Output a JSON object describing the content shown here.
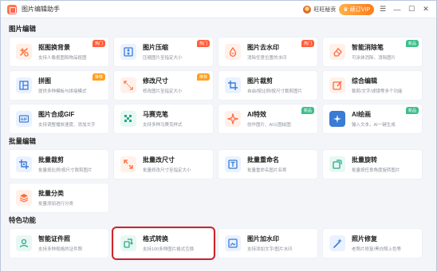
{
  "app": {
    "title": "图片编辑助手",
    "user_name": "旺旺秘贡",
    "vip_label": "续订VIP"
  },
  "colors": {
    "hot": "#ff5f3d",
    "recommend": "#ff9f1c",
    "new": "#3bbf8a",
    "highlight": "#d0232a"
  },
  "sections": [
    {
      "title": "图片编辑",
      "cards": [
        {
          "name": "抠图换背景",
          "desc": "支持人像抠图和物品抠图",
          "badge": "热门",
          "badge_type": "hot",
          "icon": "cutout-icon",
          "icon_color": "#ff7a45",
          "icon_bg": "#fff1ea"
        },
        {
          "name": "图片压缩",
          "desc": "压缩图片至指定大小",
          "badge": "热门",
          "badge_type": "hot",
          "icon": "compress-icon",
          "icon_color": "#3a7bd5",
          "icon_bg": "#eaf2ff"
        },
        {
          "name": "图片去水印",
          "desc": "消除任意位置的水印",
          "badge": "热门",
          "badge_type": "hot",
          "icon": "watermark-remove-icon",
          "icon_color": "#ff6a3d",
          "icon_bg": "#fff1ea"
        },
        {
          "name": "智能消除笔",
          "desc": "可涂抹消除，消除图片",
          "badge": "新品",
          "badge_type": "new",
          "icon": "eraser-icon",
          "icon_color": "#ff6a3d",
          "icon_bg": "#fff1ea"
        },
        {
          "name": "拼图",
          "desc": "提供多种模板与拼接模式",
          "badge": "推荐",
          "badge_type": "rec",
          "icon": "collage-icon",
          "icon_color": "#3a7bd5",
          "icon_bg": "#eaf2ff"
        },
        {
          "name": "修改尺寸",
          "desc": "修改图片至指定大小",
          "badge": "推荐",
          "badge_type": "rec",
          "icon": "resize-icon",
          "icon_color": "#ff6a3d",
          "icon_bg": "#fff1ea"
        },
        {
          "name": "图片裁剪",
          "desc": "自由/按比例/按尺寸裁剪图片",
          "badge": "",
          "badge_type": "",
          "icon": "crop-icon",
          "icon_color": "#3a7bd5",
          "icon_bg": "#eaf2ff"
        },
        {
          "name": "综合编辑",
          "desc": "裁剪/文字/滤镜等多个功能",
          "badge": "",
          "badge_type": "",
          "icon": "edit-icon",
          "icon_color": "#ff6a3d",
          "icon_bg": "#fff1ea"
        },
        {
          "name": "图片合成GIF",
          "desc": "支持调整播放速度、添加文字",
          "badge": "",
          "badge_type": "",
          "icon": "gif-icon",
          "icon_color": "#3a7bd5",
          "icon_bg": "#eaf2ff"
        },
        {
          "name": "马赛克笔",
          "desc": "支持多种马赛克样式",
          "badge": "",
          "badge_type": "",
          "icon": "mosaic-icon",
          "icon_color": "#27a88a",
          "icon_bg": "#e8f7f2"
        },
        {
          "name": "AI特效",
          "desc": "创作图片、AI以图绘图",
          "badge": "新品",
          "badge_type": "new",
          "icon": "ai-effect-icon",
          "icon_color": "#ff6a3d",
          "icon_bg": "#fff1ea"
        },
        {
          "name": "AI绘画",
          "desc": "输入文本，AI一键生成",
          "badge": "新品",
          "badge_type": "new",
          "icon": "ai-paint-icon",
          "icon_color": "#ffffff",
          "icon_bg": "#3a7bd5"
        }
      ]
    },
    {
      "title": "批量编辑",
      "cards": [
        {
          "name": "批量裁剪",
          "desc": "批量按比例/按尺寸裁剪图片",
          "badge": "",
          "badge_type": "",
          "icon": "batch-crop-icon",
          "icon_color": "#3a7bd5",
          "icon_bg": "#eaf2ff"
        },
        {
          "name": "批量改尺寸",
          "desc": "批量修改尺寸至指定大小",
          "badge": "",
          "badge_type": "",
          "icon": "batch-resize-icon",
          "icon_color": "#ff6a3d",
          "icon_bg": "#fff1ea"
        },
        {
          "name": "批量重命名",
          "desc": "批量重命名图片名称",
          "badge": "",
          "badge_type": "",
          "icon": "rename-icon",
          "icon_color": "#3a7bd5",
          "icon_bg": "#eaf2ff"
        },
        {
          "name": "批量旋转",
          "desc": "批量按任意角度旋转图片",
          "badge": "",
          "badge_type": "",
          "icon": "rotate-icon",
          "icon_color": "#27a88a",
          "icon_bg": "#e8f7f2"
        },
        {
          "name": "批量分类",
          "desc": "批量添加进行分类",
          "badge": "",
          "badge_type": "",
          "icon": "classify-icon",
          "icon_color": "#ff6a3d",
          "icon_bg": "#fff1ea"
        }
      ]
    },
    {
      "title": "特色功能",
      "cards": [
        {
          "name": "智能证件照",
          "desc": "支持多种规格的证件照",
          "badge": "",
          "badge_type": "",
          "icon": "id-photo-icon",
          "icon_color": "#27a88a",
          "icon_bg": "#e8f7f2"
        },
        {
          "name": "格式转换",
          "desc": "支持100多种图片格式互换",
          "badge": "",
          "badge_type": "",
          "icon": "convert-icon",
          "icon_color": "#27a88a",
          "icon_bg": "#e8f7f2",
          "highlight": true
        },
        {
          "name": "图片加水印",
          "desc": "支持添加文字/图片水印",
          "badge": "",
          "badge_type": "",
          "icon": "add-watermark-icon",
          "icon_color": "#3a7bd5",
          "icon_bg": "#eaf2ff"
        },
        {
          "name": "照片修复",
          "desc": "老照片修复/黑白照上色等",
          "badge": "",
          "badge_type": "",
          "icon": "repair-icon",
          "icon_color": "#3a7bd5",
          "icon_bg": "#eaf2ff"
        }
      ]
    }
  ]
}
